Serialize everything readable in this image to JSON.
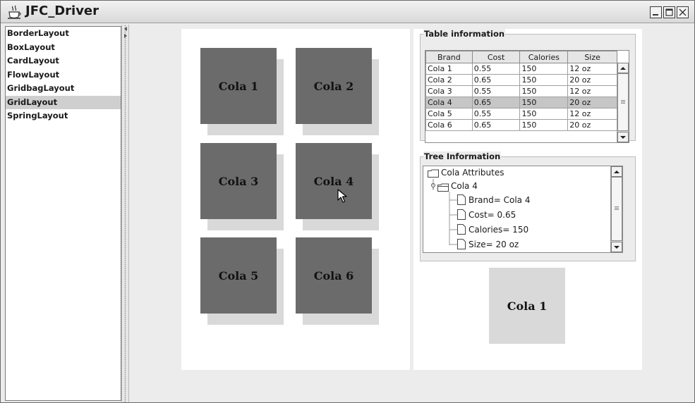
{
  "window": {
    "title": "JFC_Driver",
    "app_icon": "java-cup-icon",
    "controls": [
      "minimize-icon",
      "maximize-icon",
      "close-icon"
    ]
  },
  "layout_list": {
    "items": [
      {
        "label": "BorderLayout"
      },
      {
        "label": "BoxLayout"
      },
      {
        "label": "CardLayout"
      },
      {
        "label": "FlowLayout"
      },
      {
        "label": "GridbagLayout"
      },
      {
        "label": "GridLayout"
      },
      {
        "label": "SpringLayout"
      }
    ],
    "selected": "GridLayout"
  },
  "grid": {
    "cells": [
      {
        "label": "Cola 1"
      },
      {
        "label": "Cola 2"
      },
      {
        "label": "Cola 3"
      },
      {
        "label": "Cola 4"
      },
      {
        "label": "Cola 5"
      },
      {
        "label": "Cola 6"
      }
    ]
  },
  "table_info": {
    "title": "Table information",
    "columns": [
      "Brand",
      "Cost",
      "Calories",
      "Size"
    ],
    "rows": [
      [
        "Cola 1",
        "0.55",
        "150",
        "12 oz"
      ],
      [
        "Cola 2",
        "0.65",
        "150",
        "20 oz"
      ],
      [
        "Cola 3",
        "0.55",
        "150",
        "12 oz"
      ],
      [
        "Cola 4",
        "0.65",
        "150",
        "20 oz"
      ],
      [
        "Cola 5",
        "0.55",
        "150",
        "12 oz"
      ],
      [
        "Cola 6",
        "0.65",
        "150",
        "20 oz"
      ]
    ],
    "selected_row": "Cola 4"
  },
  "tree_info": {
    "title": "Tree Information",
    "root": "Cola Attributes",
    "node": "Cola 4",
    "leaves": [
      "Brand= Cola 4",
      "Cost= 0.65",
      "Calories= 150",
      "Size= 20 oz"
    ]
  },
  "preview": {
    "label": "Cola 1"
  },
  "colors": {
    "cell_face": "#6b6b6b",
    "cell_shadow": "#d9d9d9",
    "selection": "#cfcfcf",
    "panel_bg": "#ececec"
  }
}
